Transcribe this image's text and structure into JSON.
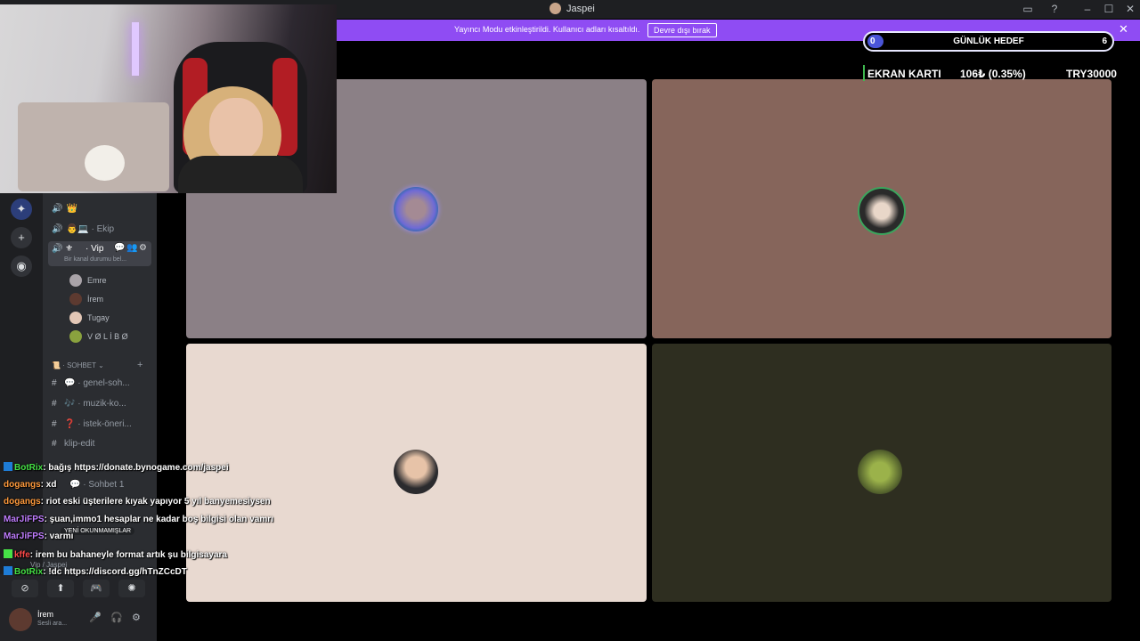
{
  "window": {
    "title": "Jaspei"
  },
  "banner": {
    "message": "Yayıncı Modu etkinleştirildi. Kullanıcı adları kısaltıldı.",
    "button": "Devre dışı bırak"
  },
  "goal": {
    "label": "GÜNLÜK HEDEF",
    "current": "0",
    "target": "6",
    "progress": 0.05
  },
  "ticker": {
    "product": "EKRAN KARTI",
    "change": "106₺ (0.35%)",
    "price": "TRY30000"
  },
  "sidebar": {
    "channels_top": [
      {
        "icon": "👑",
        "label": ""
      },
      {
        "icon": "👨💻",
        "label": "· Ekip"
      }
    ],
    "vip": {
      "label": "· Vip",
      "status": "Bir kanal durumu bel..."
    },
    "members": [
      "Emre",
      "İrem",
      "Tugay",
      "V Ø L İ B Ø"
    ],
    "category": "· SOHBET",
    "text_channels": [
      {
        "icon": "💬",
        "label": "· genel-soh..."
      },
      {
        "icon": "🎶",
        "label": "· muzik-ko..."
      },
      {
        "icon": "❓",
        "label": "· istek-öneri..."
      },
      {
        "icon": "",
        "label": "klip-edit"
      }
    ],
    "voice_channel": "· Sohbet 1",
    "unread": "YENİ OKUNMAMIŞLAR",
    "voice_path": "Vip / Jaspei"
  },
  "user": {
    "name": "İrem",
    "status": "Sesli ara..."
  },
  "chat": [
    {
      "user": "BotRix",
      "text": ": bağış https://donate.bynogame.com/jaspei",
      "color": "#46e246",
      "icon": true
    },
    {
      "user": "dogangs",
      "text": ": xd",
      "color": "#ff9a3c",
      "icon": false
    },
    {
      "user": "dogangs",
      "text": ": riot eski üşterilere kıyak yapıyor 5 yıl banyemesiysen",
      "color": "#ff9a3c",
      "icon": false
    },
    {
      "user": "MarJiFPS",
      "text": ": şuan,immo1 hesaplar ne kadar boş bilgisi olan vamrı",
      "color": "#c07dff",
      "icon": false
    },
    {
      "user": "MarJiFPS",
      "text": ": varmı",
      "color": "#c07dff",
      "icon": false
    },
    {
      "user": "kffe",
      "text": ": irem bu bahaneyle format artık şu bilgisayara",
      "color": "#ff4a4a",
      "icon": true
    },
    {
      "user": "BotRix",
      "text": ": !dc https://discord.gg/hTnZCcDT",
      "color": "#46e246",
      "icon": true
    }
  ],
  "colors": {
    "tile1": "#8b8086",
    "tile2": "#86655b",
    "tile3": "#e8d9d0",
    "tile4": "#2e2e20",
    "banner": "#8f4cf3"
  }
}
